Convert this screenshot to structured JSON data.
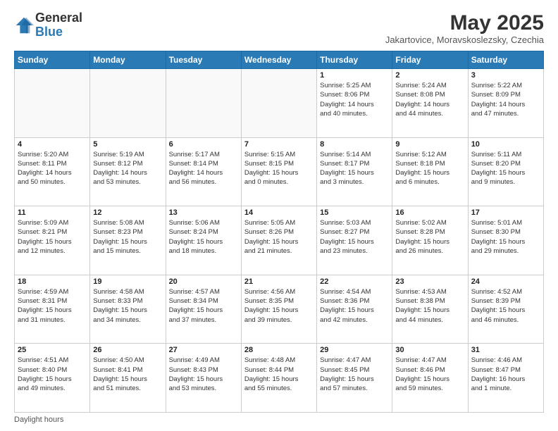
{
  "logo": {
    "general": "General",
    "blue": "Blue"
  },
  "title": "May 2025",
  "subtitle": "Jakartovice, Moravskoslezsky, Czechia",
  "days_header": [
    "Sunday",
    "Monday",
    "Tuesday",
    "Wednesday",
    "Thursday",
    "Friday",
    "Saturday"
  ],
  "footer": "Daylight hours",
  "weeks": [
    [
      {
        "day": "",
        "info": ""
      },
      {
        "day": "",
        "info": ""
      },
      {
        "day": "",
        "info": ""
      },
      {
        "day": "",
        "info": ""
      },
      {
        "day": "1",
        "info": "Sunrise: 5:25 AM\nSunset: 8:06 PM\nDaylight: 14 hours\nand 40 minutes."
      },
      {
        "day": "2",
        "info": "Sunrise: 5:24 AM\nSunset: 8:08 PM\nDaylight: 14 hours\nand 44 minutes."
      },
      {
        "day": "3",
        "info": "Sunrise: 5:22 AM\nSunset: 8:09 PM\nDaylight: 14 hours\nand 47 minutes."
      }
    ],
    [
      {
        "day": "4",
        "info": "Sunrise: 5:20 AM\nSunset: 8:11 PM\nDaylight: 14 hours\nand 50 minutes."
      },
      {
        "day": "5",
        "info": "Sunrise: 5:19 AM\nSunset: 8:12 PM\nDaylight: 14 hours\nand 53 minutes."
      },
      {
        "day": "6",
        "info": "Sunrise: 5:17 AM\nSunset: 8:14 PM\nDaylight: 14 hours\nand 56 minutes."
      },
      {
        "day": "7",
        "info": "Sunrise: 5:15 AM\nSunset: 8:15 PM\nDaylight: 15 hours\nand 0 minutes."
      },
      {
        "day": "8",
        "info": "Sunrise: 5:14 AM\nSunset: 8:17 PM\nDaylight: 15 hours\nand 3 minutes."
      },
      {
        "day": "9",
        "info": "Sunrise: 5:12 AM\nSunset: 8:18 PM\nDaylight: 15 hours\nand 6 minutes."
      },
      {
        "day": "10",
        "info": "Sunrise: 5:11 AM\nSunset: 8:20 PM\nDaylight: 15 hours\nand 9 minutes."
      }
    ],
    [
      {
        "day": "11",
        "info": "Sunrise: 5:09 AM\nSunset: 8:21 PM\nDaylight: 15 hours\nand 12 minutes."
      },
      {
        "day": "12",
        "info": "Sunrise: 5:08 AM\nSunset: 8:23 PM\nDaylight: 15 hours\nand 15 minutes."
      },
      {
        "day": "13",
        "info": "Sunrise: 5:06 AM\nSunset: 8:24 PM\nDaylight: 15 hours\nand 18 minutes."
      },
      {
        "day": "14",
        "info": "Sunrise: 5:05 AM\nSunset: 8:26 PM\nDaylight: 15 hours\nand 21 minutes."
      },
      {
        "day": "15",
        "info": "Sunrise: 5:03 AM\nSunset: 8:27 PM\nDaylight: 15 hours\nand 23 minutes."
      },
      {
        "day": "16",
        "info": "Sunrise: 5:02 AM\nSunset: 8:28 PM\nDaylight: 15 hours\nand 26 minutes."
      },
      {
        "day": "17",
        "info": "Sunrise: 5:01 AM\nSunset: 8:30 PM\nDaylight: 15 hours\nand 29 minutes."
      }
    ],
    [
      {
        "day": "18",
        "info": "Sunrise: 4:59 AM\nSunset: 8:31 PM\nDaylight: 15 hours\nand 31 minutes."
      },
      {
        "day": "19",
        "info": "Sunrise: 4:58 AM\nSunset: 8:33 PM\nDaylight: 15 hours\nand 34 minutes."
      },
      {
        "day": "20",
        "info": "Sunrise: 4:57 AM\nSunset: 8:34 PM\nDaylight: 15 hours\nand 37 minutes."
      },
      {
        "day": "21",
        "info": "Sunrise: 4:56 AM\nSunset: 8:35 PM\nDaylight: 15 hours\nand 39 minutes."
      },
      {
        "day": "22",
        "info": "Sunrise: 4:54 AM\nSunset: 8:36 PM\nDaylight: 15 hours\nand 42 minutes."
      },
      {
        "day": "23",
        "info": "Sunrise: 4:53 AM\nSunset: 8:38 PM\nDaylight: 15 hours\nand 44 minutes."
      },
      {
        "day": "24",
        "info": "Sunrise: 4:52 AM\nSunset: 8:39 PM\nDaylight: 15 hours\nand 46 minutes."
      }
    ],
    [
      {
        "day": "25",
        "info": "Sunrise: 4:51 AM\nSunset: 8:40 PM\nDaylight: 15 hours\nand 49 minutes."
      },
      {
        "day": "26",
        "info": "Sunrise: 4:50 AM\nSunset: 8:41 PM\nDaylight: 15 hours\nand 51 minutes."
      },
      {
        "day": "27",
        "info": "Sunrise: 4:49 AM\nSunset: 8:43 PM\nDaylight: 15 hours\nand 53 minutes."
      },
      {
        "day": "28",
        "info": "Sunrise: 4:48 AM\nSunset: 8:44 PM\nDaylight: 15 hours\nand 55 minutes."
      },
      {
        "day": "29",
        "info": "Sunrise: 4:47 AM\nSunset: 8:45 PM\nDaylight: 15 hours\nand 57 minutes."
      },
      {
        "day": "30",
        "info": "Sunrise: 4:47 AM\nSunset: 8:46 PM\nDaylight: 15 hours\nand 59 minutes."
      },
      {
        "day": "31",
        "info": "Sunrise: 4:46 AM\nSunset: 8:47 PM\nDaylight: 16 hours\nand 1 minute."
      }
    ]
  ]
}
